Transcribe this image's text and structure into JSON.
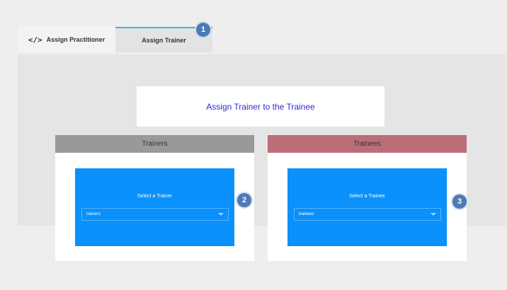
{
  "tabs": {
    "assign_practitioner": {
      "label": "Assign Practitioner",
      "icon": "code-icon",
      "icon_glyph": "</>"
    },
    "assign_trainer": {
      "label": "Assign Trainer"
    }
  },
  "title": "Assign Trainer to the Trainee",
  "trainers": {
    "header": "Trainers",
    "select_label": "Select a Trainer",
    "select_value": "trainers"
  },
  "trainees": {
    "header": "Trainees",
    "select_label": "Select a Trainee",
    "select_value": "trainees"
  },
  "badges": {
    "one": "1",
    "two": "2",
    "three": "3"
  },
  "colors": {
    "accent": "#31b6e6",
    "title_text": "#2d2ad8",
    "trainers_header": "#989a98",
    "trainees_header": "#bb6e78",
    "select_card": "#0a91fb",
    "badge": "#4d7ab5"
  }
}
